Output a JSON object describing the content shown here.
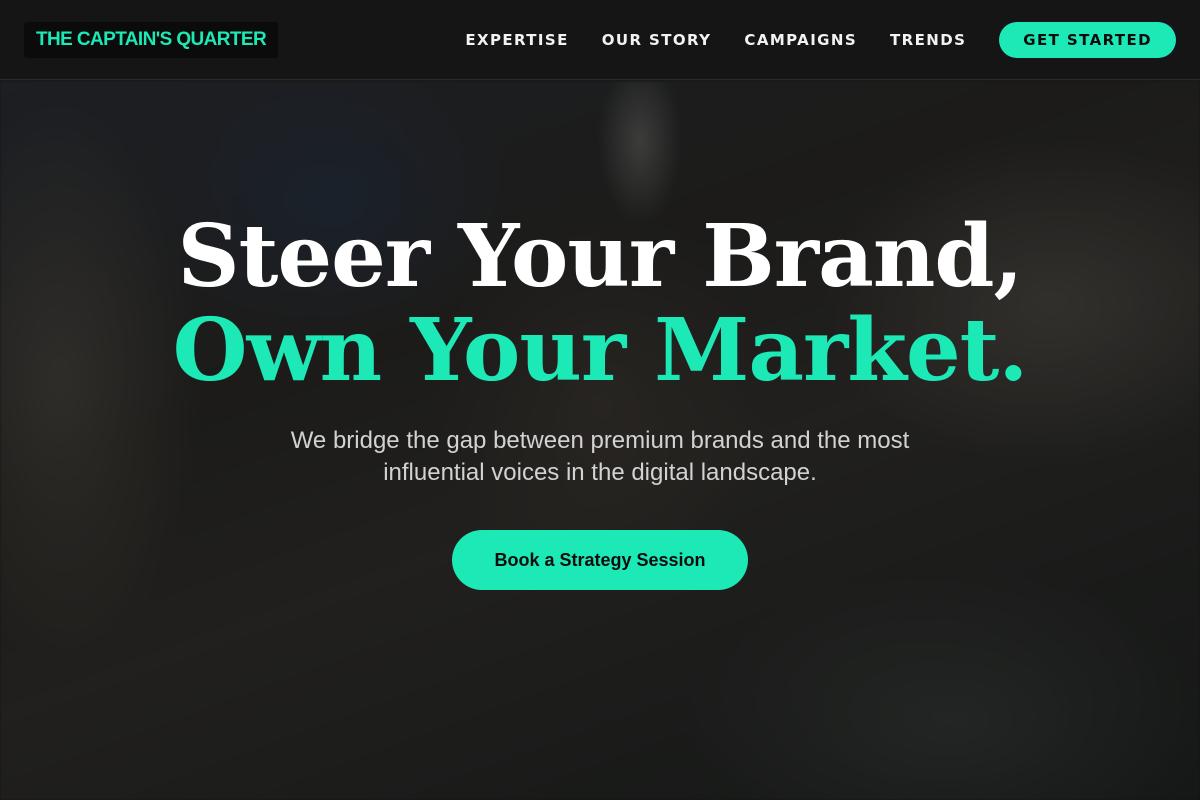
{
  "brand": {
    "logo_text": "THE CAPTAIN'S QUARTER",
    "accent_color": "#1de9b6"
  },
  "nav": {
    "links": [
      {
        "label": "EXPERTISE"
      },
      {
        "label": "OUR STORY"
      },
      {
        "label": "CAMPAIGNS"
      },
      {
        "label": "TRENDS"
      }
    ],
    "cta_label": "GET STARTED"
  },
  "hero": {
    "headline_line1": "Steer Your Brand,",
    "headline_line2": "Own Your Market.",
    "subtext": "We bridge the gap between premium brands and the most influential voices in the digital landscape.",
    "cta_label": "Book a Strategy Session",
    "background_image": "woman-with-glasses-office-photo"
  }
}
